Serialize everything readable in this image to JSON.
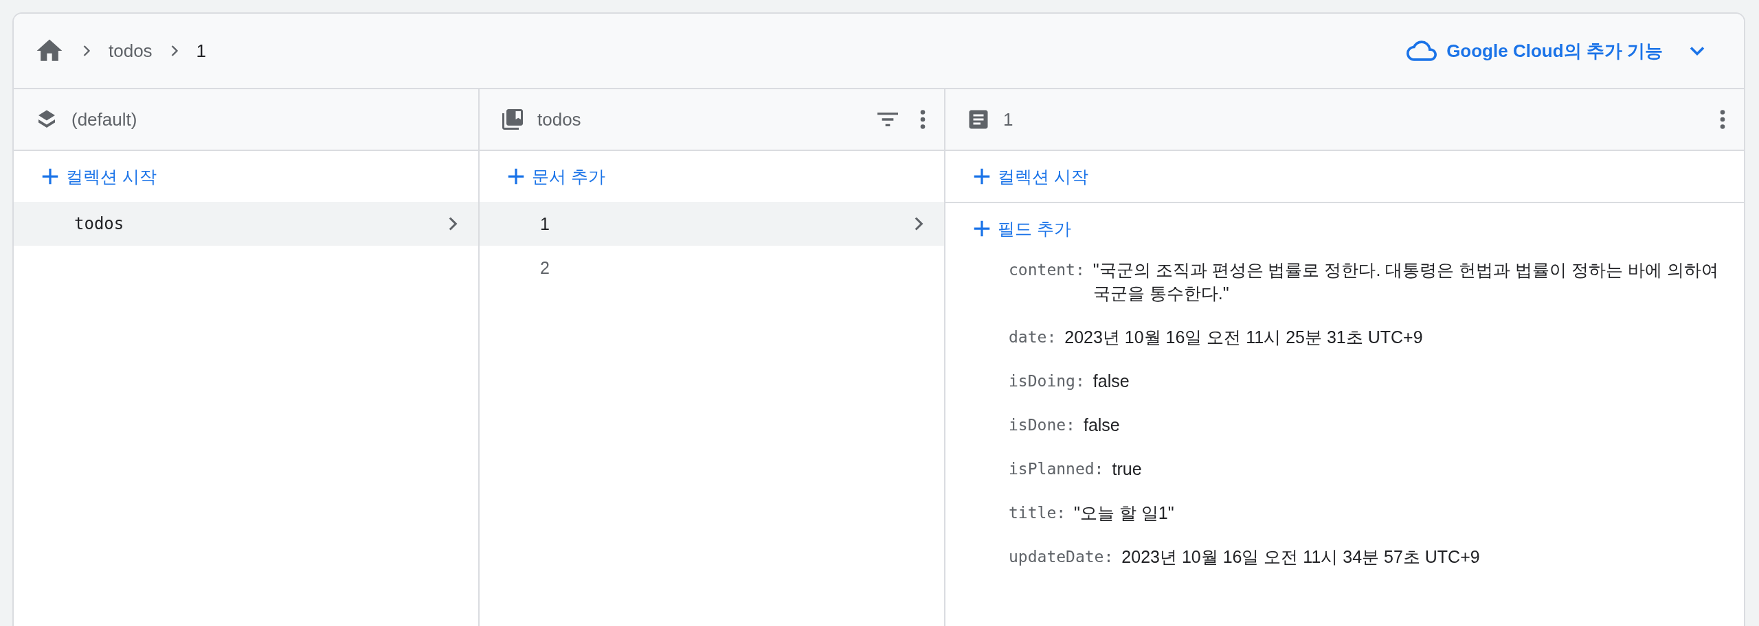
{
  "breadcrumb": [
    {
      "label": "todos"
    },
    {
      "label": "1"
    }
  ],
  "cloud_menu": {
    "label": "Google Cloud의 추가 기능"
  },
  "columns": [
    {
      "kind": "database",
      "title": "(default)",
      "add_buttons": [
        "컬렉션 시작"
      ],
      "items": [
        {
          "label": "todos",
          "selected": true
        }
      ]
    },
    {
      "kind": "collection",
      "title": "todos",
      "add_buttons": [
        "문서 추가"
      ],
      "items": [
        {
          "label": "1",
          "selected": true
        },
        {
          "label": "2",
          "selected": false
        }
      ]
    },
    {
      "kind": "document",
      "title": "1",
      "add_buttons": [
        "컬렉션 시작",
        "필드 추가"
      ],
      "fields": [
        {
          "key": "content:",
          "value": "\"국군의 조직과 편성은 법률로 정한다. 대통령은 헌법과 법률이 정하는 바에 의하여 국군을 통수한다.\""
        },
        {
          "key": "date:",
          "value": "2023년 10월 16일 오전 11시 25분 31초 UTC+9"
        },
        {
          "key": "isDoing:",
          "value": "false"
        },
        {
          "key": "isDone:",
          "value": "false"
        },
        {
          "key": "isPlanned:",
          "value": "true"
        },
        {
          "key": "title:",
          "value": "\"오늘 할 일1\""
        },
        {
          "key": "updateDate:",
          "value": "2023년 10월 16일 오전 11시 34분 57초 UTC+9"
        }
      ]
    }
  ]
}
